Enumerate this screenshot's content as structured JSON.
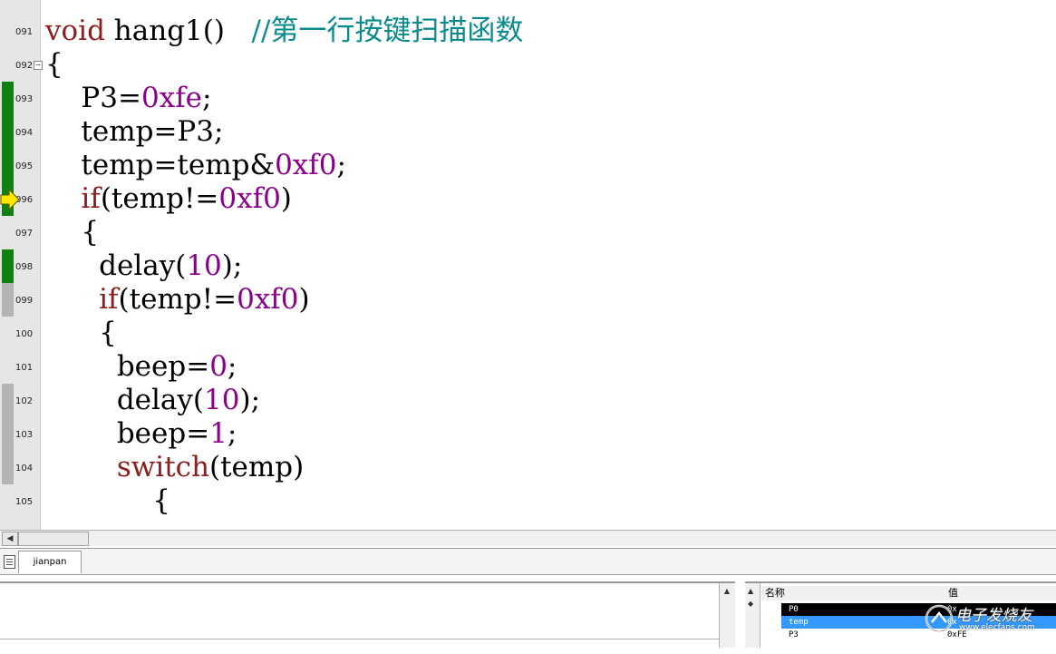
{
  "editor": {
    "lines": [
      {
        "num": "091",
        "marker": "none",
        "segments": [
          {
            "t": "void",
            "c": "kw"
          },
          {
            "t": " hang1()   ",
            "c": ""
          },
          {
            "t": "//第一行按键扫描函数",
            "c": "cmt"
          }
        ]
      },
      {
        "num": "092",
        "marker": "none",
        "fold": "−",
        "segments": [
          {
            "t": "{",
            "c": ""
          }
        ]
      },
      {
        "num": "093",
        "marker": "green",
        "segments": [
          {
            "t": "    P3=",
            "c": ""
          },
          {
            "t": "0xfe",
            "c": "num"
          },
          {
            "t": ";",
            "c": ""
          }
        ]
      },
      {
        "num": "094",
        "marker": "green",
        "segments": [
          {
            "t": "    temp=P3;",
            "c": ""
          }
        ]
      },
      {
        "num": "095",
        "marker": "green",
        "segments": [
          {
            "t": "    temp=temp&",
            "c": ""
          },
          {
            "t": "0xf0",
            "c": "num"
          },
          {
            "t": ";",
            "c": ""
          }
        ]
      },
      {
        "num": "096",
        "marker": "green",
        "current": true,
        "segments": [
          {
            "t": "    ",
            "c": ""
          },
          {
            "t": "if",
            "c": "kw"
          },
          {
            "t": "(temp!=",
            "c": ""
          },
          {
            "t": "0xf0",
            "c": "num"
          },
          {
            "t": ")",
            "c": ""
          }
        ]
      },
      {
        "num": "097",
        "marker": "none",
        "segments": [
          {
            "t": "    {",
            "c": ""
          }
        ]
      },
      {
        "num": "098",
        "marker": "green",
        "segments": [
          {
            "t": "      delay(",
            "c": ""
          },
          {
            "t": "10",
            "c": "num"
          },
          {
            "t": ");",
            "c": ""
          }
        ]
      },
      {
        "num": "099",
        "marker": "gray",
        "segments": [
          {
            "t": "      ",
            "c": ""
          },
          {
            "t": "if",
            "c": "kw"
          },
          {
            "t": "(temp!=",
            "c": ""
          },
          {
            "t": "0xf0",
            "c": "num"
          },
          {
            "t": ")",
            "c": ""
          }
        ]
      },
      {
        "num": "100",
        "marker": "none",
        "segments": [
          {
            "t": "      {",
            "c": ""
          }
        ]
      },
      {
        "num": "101",
        "marker": "none",
        "segments": [
          {
            "t": "        beep=",
            "c": ""
          },
          {
            "t": "0",
            "c": "num"
          },
          {
            "t": ";",
            "c": ""
          }
        ]
      },
      {
        "num": "102",
        "marker": "gray",
        "segments": [
          {
            "t": "        delay(",
            "c": ""
          },
          {
            "t": "10",
            "c": "num"
          },
          {
            "t": ");",
            "c": ""
          }
        ]
      },
      {
        "num": "103",
        "marker": "gray",
        "segments": [
          {
            "t": "        beep=",
            "c": ""
          },
          {
            "t": "1",
            "c": "num"
          },
          {
            "t": ";",
            "c": ""
          }
        ]
      },
      {
        "num": "104",
        "marker": "gray",
        "segments": [
          {
            "t": "        ",
            "c": ""
          },
          {
            "t": "switch",
            "c": "kw"
          },
          {
            "t": "(temp)",
            "c": ""
          }
        ]
      },
      {
        "num": "105",
        "marker": "none",
        "segments": [
          {
            "t": "            {",
            "c": ""
          }
        ]
      }
    ]
  },
  "icons": {
    "current_line": "yellow-arrow-icon",
    "file_tab": "document-icon",
    "scroll_left": "arrow-left-icon",
    "scroll_up": "arrow-up-icon"
  },
  "colors": {
    "keyword": "#8b1d1d",
    "number": "#8b008b",
    "comment": "#0a8b8b",
    "executed_marker": "#108010",
    "current_arrow": "#ffe800",
    "selection": "#3399ff"
  },
  "tabs": [
    {
      "label": "jianpan"
    }
  ],
  "watch": {
    "headers": {
      "name": "名称",
      "value": "值"
    },
    "rows": [
      {
        "name": "P0",
        "value": "0x"
      },
      {
        "name": "temp",
        "value": "0x"
      },
      {
        "name": "P3",
        "value": "0xFE"
      },
      {
        "name": "",
        "value": ""
      }
    ]
  },
  "watermark": {
    "text": "电子发烧友",
    "url": "www.elecfans.com"
  }
}
